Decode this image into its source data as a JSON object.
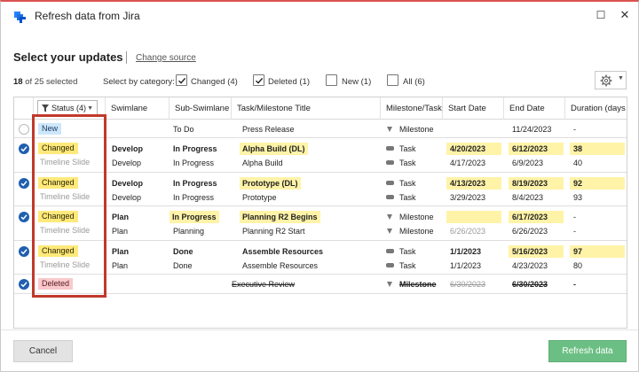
{
  "window": {
    "title": "Refresh data from Jira",
    "maximize_glyph": "☐",
    "close_glyph": "✕"
  },
  "header": {
    "title": "Select your updates",
    "change_source": "Change source"
  },
  "selection": {
    "selected": "18",
    "of_total": "of 25 selected",
    "select_by_label": "Select by category:",
    "categories": [
      {
        "label": "Changed (4)",
        "checked": true
      },
      {
        "label": "Deleted (1)",
        "checked": true
      },
      {
        "label": "New (1)",
        "checked": false
      },
      {
        "label": "All (6)",
        "checked": false
      }
    ]
  },
  "toolbar": {
    "settings_icon": "gear-icon",
    "caret": "▼"
  },
  "table": {
    "status_filter_label": "Status (4)",
    "filter_caret": "▼",
    "columns": [
      "Swimlane",
      "Sub-Swimlane",
      "Task/Milestone Title",
      "Milestone/Task",
      "Start Date",
      "End Date",
      "Duration (days"
    ],
    "rows": [
      {
        "checked": false,
        "badge": "New",
        "badge_type": "new",
        "lines": [
          {
            "swimlane": "",
            "sub": "To Do",
            "title": "Press Release",
            "type": "Milestone",
            "start": "",
            "end": "11/24/2023",
            "duration": "-"
          }
        ]
      },
      {
        "checked": true,
        "badge": "Changed",
        "badge_type": "changed",
        "sub_status": "Timeline Slide",
        "lines": [
          {
            "swimlane": "Develop",
            "sub": "In Progress",
            "title": "Alpha Build (DL)",
            "type": "Task",
            "start": "4/20/2023",
            "end": "6/12/2023",
            "duration": "38"
          },
          {
            "swimlane": "Develop",
            "sub": "In Progress",
            "title": "Alpha Build",
            "type": "Task",
            "start": "4/17/2023",
            "end": "6/9/2023",
            "duration": "40"
          }
        ]
      },
      {
        "checked": true,
        "badge": "Changed",
        "badge_type": "changed",
        "sub_status": "Timeline Slide",
        "lines": [
          {
            "swimlane": "Develop",
            "sub": "In Progress",
            "title": "Prototype (DL)",
            "type": "Task",
            "start": "4/13/2023",
            "end": "8/19/2023",
            "duration": "92"
          },
          {
            "swimlane": "Develop",
            "sub": "In Progress",
            "title": "Prototype",
            "type": "Task",
            "start": "3/29/2023",
            "end": "8/4/2023",
            "duration": "93"
          }
        ]
      },
      {
        "checked": true,
        "badge": "Changed",
        "badge_type": "changed",
        "sub_status": "Timeline Slide",
        "lines": [
          {
            "swimlane": "Plan",
            "sub": "In Progress",
            "title": "Planning R2 Begins",
            "type": "Milestone",
            "start": "",
            "end": "6/17/2023",
            "duration": "-"
          },
          {
            "swimlane": "Plan",
            "sub": "Planning",
            "title": "Planning R2 Start",
            "type": "Milestone",
            "start": "6/26/2023",
            "end": "6/26/2023",
            "duration": "-"
          }
        ]
      },
      {
        "checked": true,
        "badge": "Changed",
        "badge_type": "changed",
        "sub_status": "Timeline Slide",
        "lines": [
          {
            "swimlane": "Plan",
            "sub": "Done",
            "title": "Assemble Resources",
            "type": "Task",
            "start": "1/1/2023",
            "end": "5/16/2023",
            "duration": "97"
          },
          {
            "swimlane": "Plan",
            "sub": "Done",
            "title": "Assemble Resources",
            "type": "Task",
            "start": "1/1/2023",
            "end": "4/23/2023",
            "duration": "80"
          }
        ]
      },
      {
        "checked": true,
        "badge": "Deleted",
        "badge_type": "deleted",
        "lines": [
          {
            "swimlane": "",
            "sub": "",
            "title": "Executive Review",
            "type": "Milestone",
            "start": "6/30/2023",
            "end": "6/30/2023",
            "duration": "-"
          }
        ]
      }
    ]
  },
  "footer": {
    "cancel": "Cancel",
    "refresh": "Refresh data"
  },
  "colors": {
    "accent_red": "#c0392b",
    "checked_blue": "#1f5fb0",
    "highlight_yellow": "#fff3a8",
    "refresh_green": "#6cbf84"
  }
}
